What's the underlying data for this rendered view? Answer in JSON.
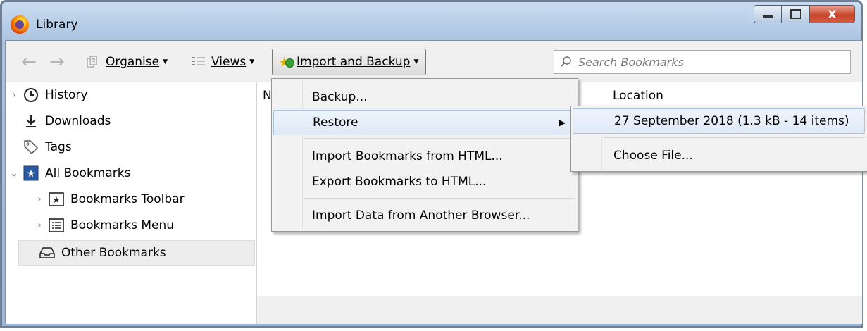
{
  "window": {
    "title": "Library",
    "close_glyph": "X"
  },
  "toolbar": {
    "organise_label": "Organise",
    "views_label": "Views",
    "import_backup_label": "Import and Backup",
    "search_placeholder": "Search Bookmarks"
  },
  "sidebar": {
    "items": [
      {
        "label": "History",
        "icon": "clock-icon",
        "twisty": "›"
      },
      {
        "label": "Downloads",
        "icon": "download-arrow-icon"
      },
      {
        "label": "Tags",
        "icon": "tag-icon"
      },
      {
        "label": "All Bookmarks",
        "icon": "star-folder-icon",
        "twisty": "⌄"
      },
      {
        "label": "Bookmarks Toolbar",
        "icon": "star-box-icon",
        "twisty": "›"
      },
      {
        "label": "Bookmarks Menu",
        "icon": "menu-list-icon",
        "twisty": "›"
      },
      {
        "label": "Other Bookmarks",
        "icon": "tray-icon",
        "selected": true
      }
    ]
  },
  "columns": {
    "name_partial": "N",
    "location": "Location"
  },
  "import_menu": {
    "backup": "Backup...",
    "restore": "Restore",
    "import_html": "Import Bookmarks from HTML...",
    "export_html": "Export Bookmarks to HTML...",
    "import_browser": "Import Data from Another Browser..."
  },
  "restore_submenu": {
    "backup_entry": "27 September 2018 (1.3 kB - 14 items)",
    "choose_file": "Choose File..."
  },
  "colors": {
    "window_frame": "#a8c2e0",
    "highlight": "#dfeaf8",
    "close": "#c7462c"
  }
}
